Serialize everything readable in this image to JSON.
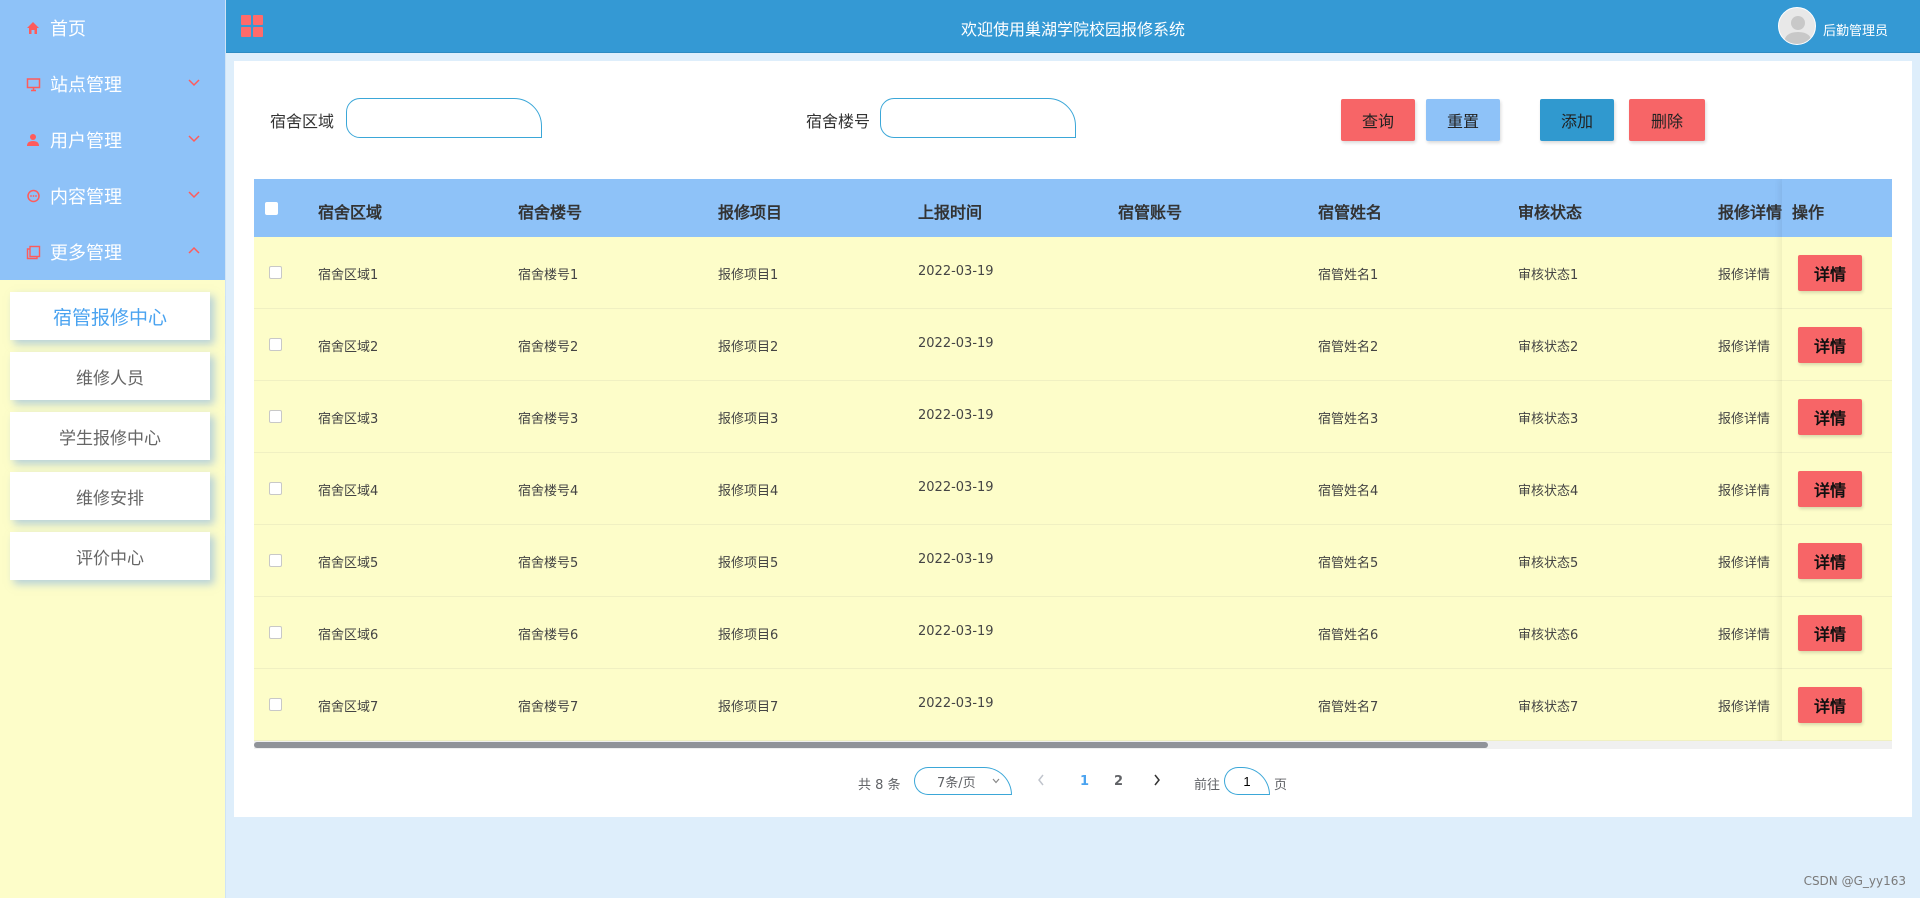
{
  "sidebar": {
    "menu": [
      {
        "label": "首页",
        "icon": "home-icon",
        "expandable": false
      },
      {
        "label": "站点管理",
        "icon": "monitor-icon",
        "expandable": true,
        "expanded": false
      },
      {
        "label": "用户管理",
        "icon": "user-icon",
        "expandable": true,
        "expanded": false
      },
      {
        "label": "内容管理",
        "icon": "chat-icon",
        "expandable": true,
        "expanded": false
      },
      {
        "label": "更多管理",
        "icon": "copy-icon",
        "expandable": true,
        "expanded": true
      }
    ],
    "submenu": [
      {
        "label": "宿管报修中心",
        "active": true
      },
      {
        "label": "维修人员",
        "active": false
      },
      {
        "label": "学生报修中心",
        "active": false
      },
      {
        "label": "维修安排",
        "active": false
      },
      {
        "label": "评价中心",
        "active": false
      }
    ]
  },
  "header": {
    "title": "欢迎使用巢湖学院校园报修系统",
    "user_name": "后勤管理员"
  },
  "search": {
    "area_label": "宿舍区域",
    "area_value": "",
    "building_label": "宿舍楼号",
    "building_value": ""
  },
  "buttons": {
    "query": "查询",
    "reset": "重置",
    "add": "添加",
    "delete": "删除",
    "detail": "详情"
  },
  "table": {
    "headers": [
      "宿舍区域",
      "宿舍楼号",
      "报修项目",
      "上报时间",
      "宿管账号",
      "宿管姓名",
      "审核状态",
      "报修详情",
      "操作"
    ],
    "rows": [
      [
        "宿舍区域1",
        "宿舍楼号1",
        "报修项目1",
        "2022-03-19",
        "",
        "宿管姓名1",
        "审核状态1",
        "报修详情"
      ],
      [
        "宿舍区域2",
        "宿舍楼号2",
        "报修项目2",
        "2022-03-19",
        "",
        "宿管姓名2",
        "审核状态2",
        "报修详情"
      ],
      [
        "宿舍区域3",
        "宿舍楼号3",
        "报修项目3",
        "2022-03-19",
        "",
        "宿管姓名3",
        "审核状态3",
        "报修详情"
      ],
      [
        "宿舍区域4",
        "宿舍楼号4",
        "报修项目4",
        "2022-03-19",
        "",
        "宿管姓名4",
        "审核状态4",
        "报修详情"
      ],
      [
        "宿舍区域5",
        "宿舍楼号5",
        "报修项目5",
        "2022-03-19",
        "",
        "宿管姓名5",
        "审核状态5",
        "报修详情"
      ],
      [
        "宿舍区域6",
        "宿舍楼号6",
        "报修项目6",
        "2022-03-19",
        "",
        "宿管姓名6",
        "审核状态6",
        "报修详情"
      ],
      [
        "宿舍区域7",
        "宿舍楼号7",
        "报修项目7",
        "2022-03-19",
        "",
        "宿管姓名7",
        "审核状态7",
        "报修详情"
      ]
    ]
  },
  "pagination": {
    "total": "共 8 条",
    "page_size": "7条/页",
    "pages": [
      "1",
      "2"
    ],
    "current_page": "1",
    "goto_label": "前往",
    "goto_value": "1",
    "goto_unit": "页"
  },
  "watermark": "CSDN @G_yy163",
  "colors": {
    "sidebar_menu_bg": "#8ec2f8",
    "sidebar_bg": "#fdfdc9",
    "header_bg": "#3499d4",
    "accent_red": "#f76567",
    "accent_blue": "#3099cf",
    "table_header_bg": "#8ec2f8",
    "table_row_bg": "#fdfdc9",
    "active_text": "#4aa3f0"
  }
}
